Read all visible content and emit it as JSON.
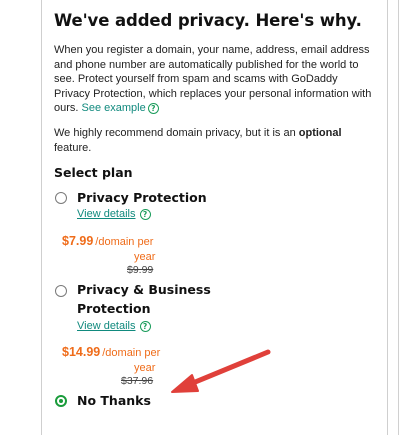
{
  "heading": "We've added privacy. Here's why.",
  "intro": {
    "text": "When you register a domain, your name, address, email address and phone number are automatically published for the world to see. Protect yourself from spam and scams with GoDaddy Privacy Protection, which replaces your personal information with ours.",
    "see_example": "See example"
  },
  "recommend": {
    "text_before": "We highly recommend domain privacy, but it is an ",
    "emphasis": "optional",
    "text_after": " feature."
  },
  "select_plan_label": "Select plan",
  "plans": [
    {
      "name": "Privacy Protection",
      "view_details": "View details",
      "price": "$7.99",
      "per_unit": "/domain per",
      "per_unit_cont": "year",
      "original_price": "$9.99",
      "selected": false
    },
    {
      "name_line1": "Privacy & Business",
      "name_line2": "Protection",
      "view_details": "View details",
      "price": "$14.99",
      "per_unit": "/domain per",
      "per_unit_cont": "year",
      "original_price": "$37.96",
      "selected": false
    },
    {
      "name": "No Thanks",
      "selected": true
    }
  ],
  "colors": {
    "accent_green": "#1a9c3b",
    "link_teal": "#118a7e",
    "price_orange": "#ef6c1a",
    "annotation_arrow": "#e0403a"
  },
  "icons": {
    "help": "question-circle-icon",
    "annotation": "red-arrow-icon"
  }
}
